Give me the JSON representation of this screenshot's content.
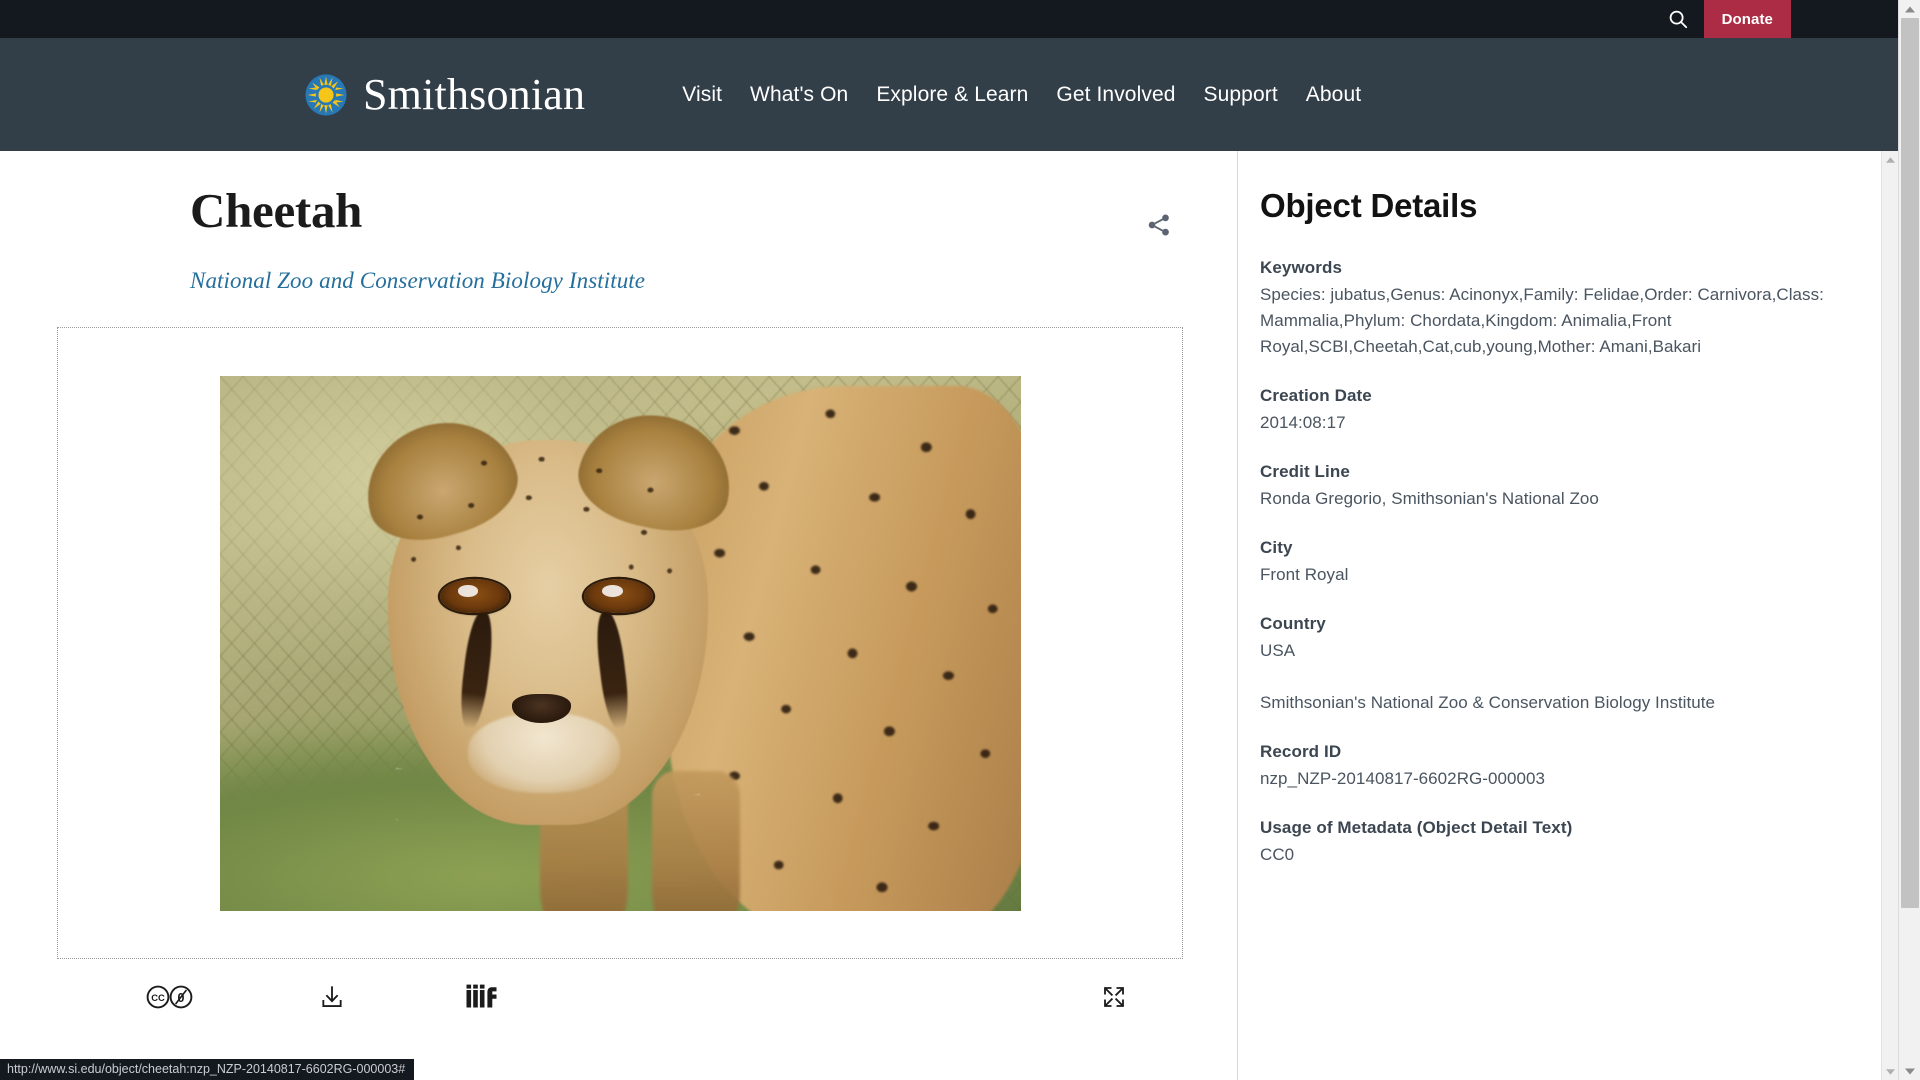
{
  "utility_bar": {
    "search_icon": "search-icon",
    "donate_label": "Donate"
  },
  "brand": {
    "logo_icon": "smithsonian-sunburst-icon",
    "name": "Smithsonian"
  },
  "nav": {
    "items": [
      {
        "label": "Visit"
      },
      {
        "label": "What's On"
      },
      {
        "label": "Explore & Learn"
      },
      {
        "label": "Get Involved"
      },
      {
        "label": "Support"
      },
      {
        "label": "About"
      }
    ]
  },
  "object": {
    "title": "Cheetah",
    "subtitle": "National Zoo and Conservation Biology Institute",
    "share_icon": "share-icon"
  },
  "viewer": {
    "image_alt": "Cheetah cub looking toward the camera",
    "tools": [
      {
        "name": "cc0-license-icon",
        "label": "CC0"
      },
      {
        "name": "download-icon",
        "label": "Download"
      },
      {
        "name": "iiif-icon",
        "label": "IIIF"
      },
      {
        "name": "fullscreen-icon",
        "label": "Full screen"
      }
    ]
  },
  "details": {
    "title": "Object Details",
    "fields": [
      {
        "label": "Keywords",
        "value": "Species: jubatus,Genus: Acinonyx,Family: Felidae,Order: Carnivora,Class: Mammalia,Phylum: Chordata,Kingdom: Animalia,Front Royal,SCBI,Cheetah,Cat,cub,young,Mother: Amani,Bakari"
      },
      {
        "label": "Creation Date",
        "value": "2014:08:17"
      },
      {
        "label": "Credit Line",
        "value": "Ronda Gregorio, Smithsonian's National Zoo"
      },
      {
        "label": "City",
        "value": "Front Royal"
      },
      {
        "label": "Country",
        "value": "USA"
      },
      {
        "label": "",
        "value": "Smithsonian's National Zoo & Conservation Biology Institute"
      },
      {
        "label": "Record ID",
        "value": "nzp_NZP-20140817-6602RG-000003"
      },
      {
        "label": "Usage of Metadata (Object Detail Text)",
        "value": "CC0"
      }
    ]
  },
  "status_bar": {
    "url": "http://www.si.edu/object/cheetah:nzp_NZP-20140817-6602RG-000003#"
  },
  "colors": {
    "utility_bar_bg": "#14181f",
    "nav_bg": "#323e48",
    "donate_bg": "#ab2c44",
    "link_blue": "#256f9c",
    "label_gray": "#3c4651",
    "value_gray": "#4a5560"
  }
}
